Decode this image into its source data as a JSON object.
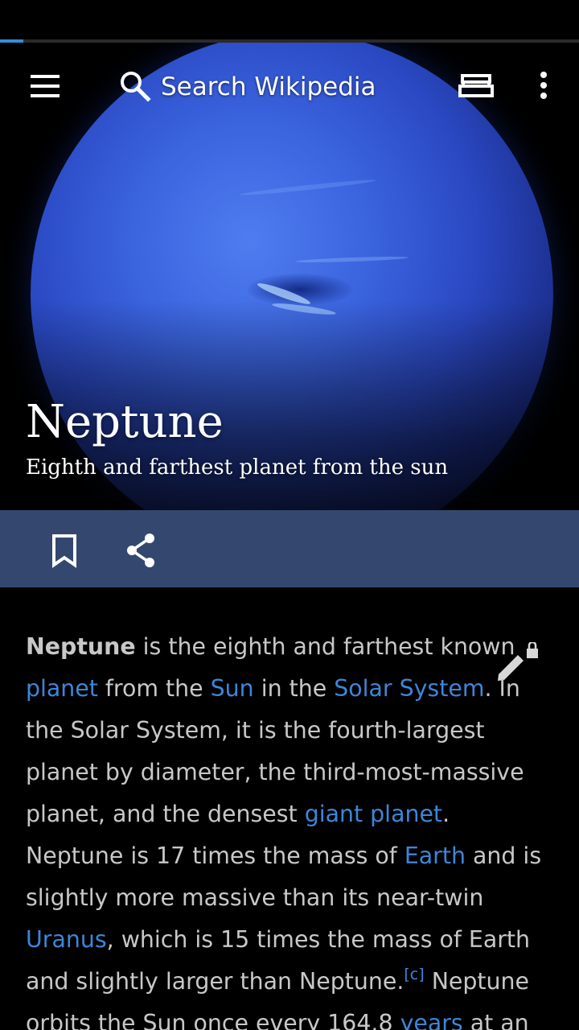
{
  "load_progress": 0.04,
  "toolbar": {
    "menu_icon": "hamburger-menu-icon",
    "search_icon": "magnifier-icon",
    "search_placeholder": "Search Wikipedia",
    "reading_lists_icon": "reading-lists-icon",
    "overflow_icon": "vertical-dots-icon"
  },
  "article": {
    "title": "Neptune",
    "description": "Eighth and farthest planet from the sun",
    "actions": {
      "save_icon": "bookmark-outline-icon",
      "share_icon": "share-icon"
    },
    "edit_icon": "pencil-lock-icon",
    "lead": {
      "bold_title": "Neptune",
      "t1": " is the eighth and farthest known ",
      "link_planet": "planet",
      "t2": " from the ",
      "link_sun": "Sun",
      "t3": " in the ",
      "link_solar_system": "Solar System",
      "t4": ". In the Solar System, it is the fourth-largest planet by diameter, the third-most-massive planet, and the densest ",
      "link_giant_planet": "giant planet",
      "t5": ". Neptune is 17 times the mass of ",
      "link_earth": "Earth",
      "t6": " and is slightly more massive than its near-twin ",
      "link_uranus": "Uranus",
      "t7": ", which is 15 times the mass of Earth and slightly larger than Neptune.",
      "footnote": "[c]",
      "t8": " Neptune orbits the Sun once every 164.8 ",
      "link_years": "years",
      "t9": " at an"
    }
  },
  "colors": {
    "link": "#3d86d8",
    "action_bar": "#34486f",
    "body_text": "#c8c8c8",
    "progress": "#2f8fd8"
  }
}
